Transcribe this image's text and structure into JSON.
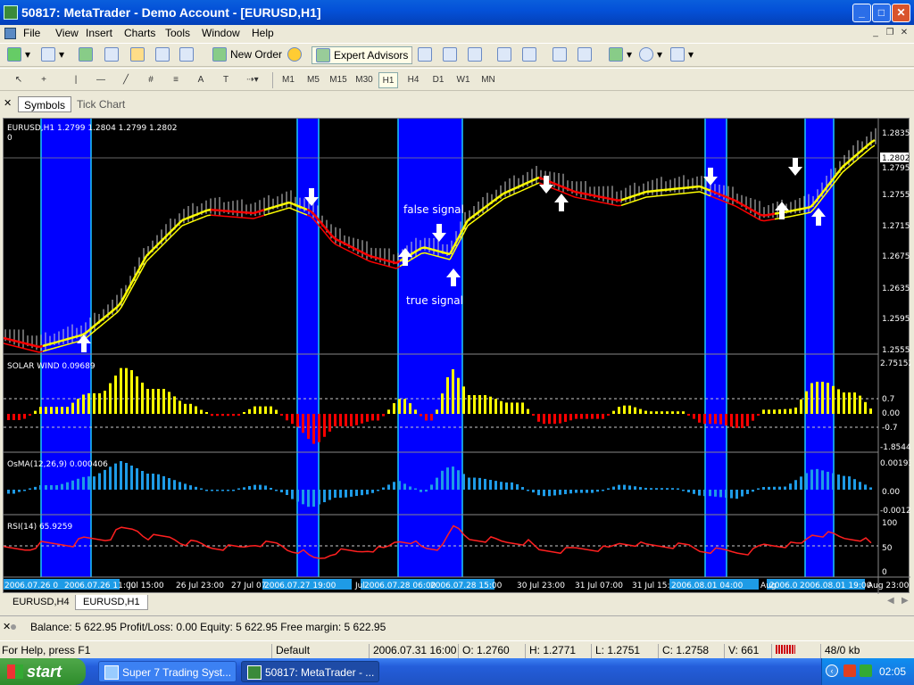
{
  "window": {
    "title": "50817: MetaTrader - Demo Account - [EURUSD,H1]"
  },
  "menu": [
    "File",
    "View",
    "Insert",
    "Charts",
    "Tools",
    "Window",
    "Help"
  ],
  "toolbar": {
    "new_order": "New Order",
    "expert_advisors": "Expert Advisors"
  },
  "timeframes": [
    "M1",
    "M5",
    "M15",
    "M30",
    "H1",
    "H4",
    "D1",
    "W1",
    "MN"
  ],
  "active_timeframe": "H1",
  "panel_tabs": {
    "symbols": "Symbols",
    "tick_chart": "Tick Chart"
  },
  "chart": {
    "header": "EURUSD,H1  1.2799 1.2804 1.2799 1.2802",
    "header_sub": "0",
    "current_price": "1.2802",
    "price_scale": [
      "1.2835",
      "1.2795",
      "1.2755",
      "1.2715",
      "1.2675",
      "1.2635",
      "1.2595",
      "1.2555"
    ],
    "annotations": {
      "false_signal": "false signal",
      "true_signal": "true signal"
    },
    "solar_wind": {
      "label": "SOLAR WIND 0.09689",
      "scale": [
        "2.75152",
        "0.7",
        "0.00",
        "-0.7",
        "-1.8544"
      ]
    },
    "osma": {
      "label": "OsMA(12,26,9) 0.000406",
      "scale": [
        "0.00193",
        "0.00",
        "-0.00126"
      ]
    },
    "rsi": {
      "label": "RSI(14) 65.9259",
      "scale": [
        "100",
        "50",
        "0"
      ]
    },
    "time_labels": [
      "2006.07.26 0",
      "2006.07.26 11:00",
      "Jul 15:00",
      "26 Jul 23:00",
      "27 Jul 07",
      "2006.07.27 19:00",
      "Jul",
      "2006.07.28 06:00",
      "2006.07.28 15:00",
      "30 Jul 23:00",
      "31 Jul 07:00",
      "31 Jul 15:",
      "2006.08.01 04:00",
      "Aug",
      "2006.0",
      "2006.08.01 19:00",
      "Aug 23:00"
    ],
    "colors": {
      "highlight": "#0000ff",
      "bull": "#ffff00",
      "bear": "#ff0000",
      "osma": "#1e9be6"
    }
  },
  "chart_tabs": [
    "EURUSD,H4",
    "EURUSD,H1"
  ],
  "active_chart_tab": "EURUSD,H1",
  "terminal": {
    "text": "Balance: 5 622.95  Profit/Loss: 0.00  Equity: 5 622.95  Free margin: 5 622.95"
  },
  "status": {
    "help": "For Help, press F1",
    "profile": "Default",
    "datetime": "2006.07.31 16:00",
    "open": "O: 1.2760",
    "high": "H: 1.2771",
    "low": "L: 1.2751",
    "close": "C: 1.2758",
    "volume": "V: 661",
    "traffic": "48/0 kb"
  },
  "taskbar": {
    "start": "start",
    "items": [
      "Super 7 Trading Syst...",
      "50817: MetaTrader - ..."
    ],
    "clock": "02:05"
  }
}
